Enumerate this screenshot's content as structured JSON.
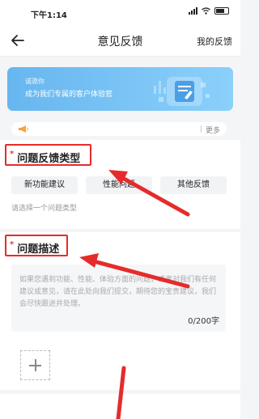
{
  "status": {
    "time": "下午1:14",
    "icons": [
      "signal-icon",
      "wifi-icon",
      "battery-icon"
    ]
  },
  "nav": {
    "title": "意见反馈",
    "right_label": "我的反馈",
    "back_icon": "arrow-left-icon"
  },
  "banner": {
    "line1": "诚邀你",
    "line2": "成为我们专属的客户体验官"
  },
  "notice": {
    "more_label": "更多",
    "icon": "megaphone-icon"
  },
  "feedback_type": {
    "required_mark": "*",
    "title": "问题反馈类型",
    "options": [
      {
        "label": "新功能建议"
      },
      {
        "label": "性能问题"
      },
      {
        "label": "其他反馈"
      }
    ],
    "hint": "请选择一个问题类型"
  },
  "description": {
    "required_mark": "*",
    "title": "问题描述",
    "placeholder": "如果您遇到功能、性能、体验方面的问题，或者对我们有任何建议或意见，请在此处向我们提交，期待您的宝贵建议，我们会尽快跟进并处理。",
    "counter": "0/200字"
  },
  "upload": {
    "icon": "plus-icon"
  },
  "colors": {
    "accent_red": "#e62b2b",
    "banner_blue": "#67b6ef",
    "notice_orange": "#f7a23b"
  }
}
